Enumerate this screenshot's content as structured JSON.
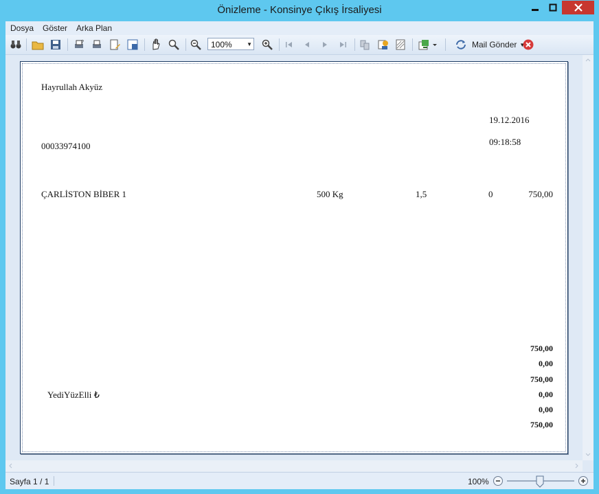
{
  "window": {
    "title": "Önizleme - Konsinye Çıkış İrsaliyesi"
  },
  "menu": [
    "Dosya",
    "Göster",
    "Arka Plan"
  ],
  "toolbar": {
    "zoom_value": "100%",
    "mail_label": "Mail Gönder"
  },
  "document": {
    "customer_name": "Hayrullah Akyüz",
    "date": "19.12.2016",
    "time": "09:18:58",
    "doc_number": "00033974100",
    "line": {
      "product": "ÇARLİSTON BİBER 1",
      "quantity": "500 Kg",
      "price": "1,5",
      "discount": "0",
      "amount": "750,00"
    },
    "amount_in_words": "YediYüzElli ₺",
    "totals": [
      "750,00",
      "0,00",
      "750,00",
      "0,00",
      "0,00",
      "750,00"
    ]
  },
  "status": {
    "page_info": "Sayfa 1 / 1",
    "zoom": "100%"
  }
}
